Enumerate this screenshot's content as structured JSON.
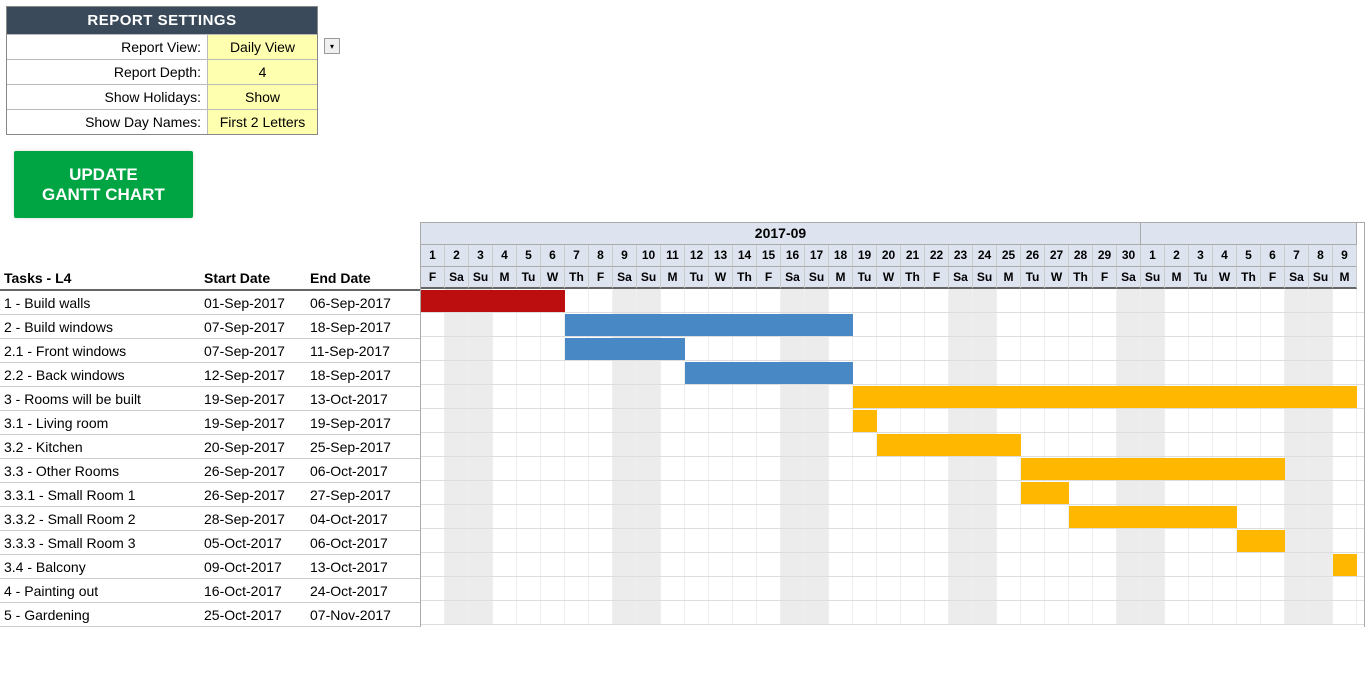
{
  "settings": {
    "title": "REPORT SETTINGS",
    "rows": [
      {
        "label": "Report View:",
        "value": "Daily View",
        "dropdown": true
      },
      {
        "label": "Report Depth:",
        "value": "4"
      },
      {
        "label": "Show Holidays:",
        "value": "Show"
      },
      {
        "label": "Show Day Names:",
        "value": "First 2 Letters"
      }
    ]
  },
  "update_button": {
    "line1": "UPDATE",
    "line2": "GANTT CHART"
  },
  "columns": {
    "tasks": "Tasks - L4",
    "start": "Start Date",
    "end": "End Date"
  },
  "timeline": {
    "months": [
      {
        "label": "2017-09",
        "days": 30
      },
      {
        "label": "",
        "days": 9
      }
    ],
    "day_numbers": [
      1,
      2,
      3,
      4,
      5,
      6,
      7,
      8,
      9,
      10,
      11,
      12,
      13,
      14,
      15,
      16,
      17,
      18,
      19,
      20,
      21,
      22,
      23,
      24,
      25,
      26,
      27,
      28,
      29,
      30,
      1,
      2,
      3,
      4,
      5,
      6,
      7,
      8,
      9
    ],
    "day_names": [
      "F",
      "Sa",
      "Su",
      "M",
      "Tu",
      "W",
      "Th",
      "F",
      "Sa",
      "Su",
      "M",
      "Tu",
      "W",
      "Th",
      "F",
      "Sa",
      "Su",
      "M",
      "Tu",
      "W",
      "Th",
      "F",
      "Sa",
      "Su",
      "M",
      "Tu",
      "W",
      "Th",
      "F",
      "Sa",
      "Su",
      "M",
      "Tu",
      "W",
      "Th",
      "F",
      "Sa",
      "Su",
      "M"
    ],
    "weekend": [
      false,
      true,
      true,
      false,
      false,
      false,
      false,
      false,
      true,
      true,
      false,
      false,
      false,
      false,
      false,
      true,
      true,
      false,
      false,
      false,
      false,
      false,
      true,
      true,
      false,
      false,
      false,
      false,
      false,
      true,
      true,
      false,
      false,
      false,
      false,
      false,
      true,
      true,
      false
    ]
  },
  "tasks": [
    {
      "name": "1 - Build walls",
      "start": "01-Sep-2017",
      "end": "06-Sep-2017",
      "bar_start": 0,
      "bar_end": 6,
      "color": "red"
    },
    {
      "name": "2 - Build windows",
      "start": "07-Sep-2017",
      "end": "18-Sep-2017",
      "bar_start": 6,
      "bar_end": 18,
      "color": "blue"
    },
    {
      "name": "2.1 - Front windows",
      "start": "07-Sep-2017",
      "end": "11-Sep-2017",
      "bar_start": 6,
      "bar_end": 11,
      "color": "blue"
    },
    {
      "name": "2.2 - Back windows",
      "start": "12-Sep-2017",
      "end": "18-Sep-2017",
      "bar_start": 11,
      "bar_end": 18,
      "color": "blue"
    },
    {
      "name": "3 - Rooms will be built",
      "start": "19-Sep-2017",
      "end": "13-Oct-2017",
      "bar_start": 18,
      "bar_end": 39,
      "color": "yellow"
    },
    {
      "name": "3.1 - Living room",
      "start": "19-Sep-2017",
      "end": "19-Sep-2017",
      "bar_start": 18,
      "bar_end": 19,
      "color": "yellow"
    },
    {
      "name": "3.2 - Kitchen",
      "start": "20-Sep-2017",
      "end": "25-Sep-2017",
      "bar_start": 19,
      "bar_end": 25,
      "color": "yellow"
    },
    {
      "name": "3.3 - Other Rooms",
      "start": "26-Sep-2017",
      "end": "06-Oct-2017",
      "bar_start": 25,
      "bar_end": 36,
      "color": "yellow"
    },
    {
      "name": "3.3.1 - Small Room 1",
      "start": "26-Sep-2017",
      "end": "27-Sep-2017",
      "bar_start": 25,
      "bar_end": 27,
      "color": "yellow"
    },
    {
      "name": "3.3.2 - Small Room 2",
      "start": "28-Sep-2017",
      "end": "04-Oct-2017",
      "bar_start": 27,
      "bar_end": 34,
      "color": "yellow"
    },
    {
      "name": "3.3.3 - Small Room 3",
      "start": "05-Oct-2017",
      "end": "06-Oct-2017",
      "bar_start": 34,
      "bar_end": 36,
      "color": "yellow"
    },
    {
      "name": "3.4 - Balcony",
      "start": "09-Oct-2017",
      "end": "13-Oct-2017",
      "bar_start": 38,
      "bar_end": 39,
      "color": "yellow"
    },
    {
      "name": "4 - Painting out",
      "start": "16-Oct-2017",
      "end": "24-Oct-2017",
      "bar_start": null,
      "bar_end": null,
      "color": null
    },
    {
      "name": "5 - Gardening",
      "start": "25-Oct-2017",
      "end": "07-Nov-2017",
      "bar_start": null,
      "bar_end": null,
      "color": null
    }
  ],
  "chart_data": {
    "type": "bar",
    "title": "Gantt Chart",
    "xlabel": "Date",
    "ylabel": "Tasks",
    "series": [
      {
        "name": "1 - Build walls",
        "start": "2017-09-01",
        "end": "2017-09-06",
        "color": "#bc0e0e"
      },
      {
        "name": "2 - Build windows",
        "start": "2017-09-07",
        "end": "2017-09-18",
        "color": "#4788c5"
      },
      {
        "name": "2.1 - Front windows",
        "start": "2017-09-07",
        "end": "2017-09-11",
        "color": "#4788c5"
      },
      {
        "name": "2.2 - Back windows",
        "start": "2017-09-12",
        "end": "2017-09-18",
        "color": "#4788c5"
      },
      {
        "name": "3 - Rooms will be built",
        "start": "2017-09-19",
        "end": "2017-10-13",
        "color": "#ffb700"
      },
      {
        "name": "3.1 - Living room",
        "start": "2017-09-19",
        "end": "2017-09-19",
        "color": "#ffb700"
      },
      {
        "name": "3.2 - Kitchen",
        "start": "2017-09-20",
        "end": "2017-09-25",
        "color": "#ffb700"
      },
      {
        "name": "3.3 - Other Rooms",
        "start": "2017-09-26",
        "end": "2017-10-06",
        "color": "#ffb700"
      },
      {
        "name": "3.3.1 - Small Room 1",
        "start": "2017-09-26",
        "end": "2017-09-27",
        "color": "#ffb700"
      },
      {
        "name": "3.3.2 - Small Room 2",
        "start": "2017-09-28",
        "end": "2017-10-04",
        "color": "#ffb700"
      },
      {
        "name": "3.3.3 - Small Room 3",
        "start": "2017-10-05",
        "end": "2017-10-06",
        "color": "#ffb700"
      },
      {
        "name": "3.4 - Balcony",
        "start": "2017-10-09",
        "end": "2017-10-13",
        "color": "#ffb700"
      },
      {
        "name": "4 - Painting out",
        "start": "2017-10-16",
        "end": "2017-10-24",
        "color": ""
      },
      {
        "name": "5 - Gardening",
        "start": "2017-10-25",
        "end": "2017-11-07",
        "color": ""
      }
    ]
  }
}
